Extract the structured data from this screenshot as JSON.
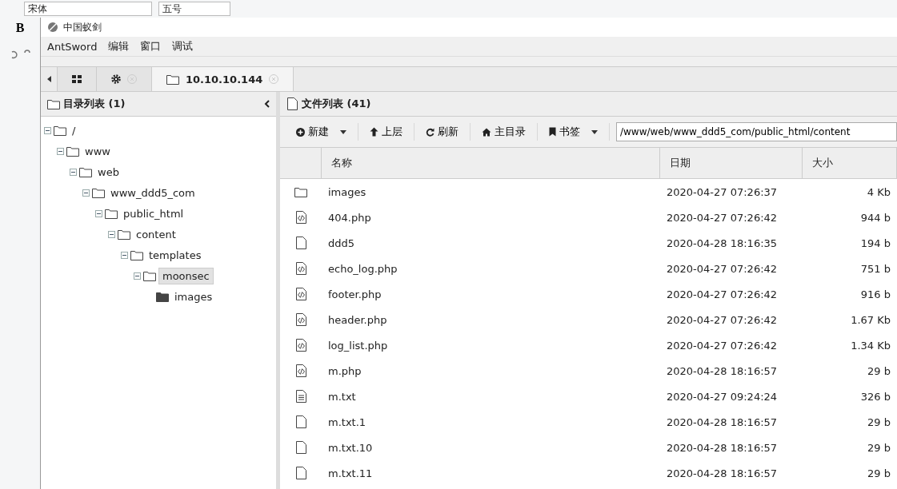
{
  "background_app": {
    "font_field": "宋体",
    "size_field": "五号",
    "bold_key": "B"
  },
  "window": {
    "title": "中国蚁剑"
  },
  "menu": [
    "AntSword",
    "编辑",
    "窗口",
    "调试"
  ],
  "tabs": [
    {
      "kind": "home",
      "selected": false
    },
    {
      "kind": "settings",
      "selected": false
    },
    {
      "kind": "host",
      "label": "10.10.10.144",
      "selected": true
    }
  ],
  "dir_panel": {
    "title": "目录列表 (1)",
    "tree": [
      {
        "label": "/",
        "selected": false,
        "children": [
          {
            "label": "www",
            "selected": false,
            "children": [
              {
                "label": "web",
                "selected": false,
                "children": [
                  {
                    "label": "www_ddd5_com",
                    "selected": false,
                    "children": [
                      {
                        "label": "public_html",
                        "selected": false,
                        "children": [
                          {
                            "label": "content",
                            "selected": false,
                            "children": [
                              {
                                "label": "templates",
                                "selected": false,
                                "children": [
                                  {
                                    "label": "moonsec",
                                    "selected": true,
                                    "children": [
                                      {
                                        "label": "images",
                                        "selected": false
                                      }
                                    ]
                                  }
                                ]
                              }
                            ]
                          }
                        ]
                      }
                    ]
                  }
                ]
              }
            ]
          }
        ]
      }
    ]
  },
  "file_panel": {
    "title": "文件列表 (41)",
    "toolbar": [
      {
        "kind": "new",
        "label": "新建",
        "dropdown": true
      },
      {
        "kind": "up",
        "label": "上层",
        "dropdown": false
      },
      {
        "kind": "refresh",
        "label": "刷新",
        "dropdown": false
      },
      {
        "kind": "home",
        "label": "主目录",
        "dropdown": false
      },
      {
        "kind": "bookmark",
        "label": "书签",
        "dropdown": true
      }
    ],
    "path": "/www/web/www_ddd5_com/public_html/content",
    "columns": [
      "名称",
      "日期",
      "大小"
    ],
    "rows": [
      {
        "kind": "folder",
        "name": "images",
        "date": "2020-04-27 07:26:37",
        "size": "4 Kb"
      },
      {
        "kind": "code",
        "name": "404.php",
        "date": "2020-04-27 07:26:42",
        "size": "944 b"
      },
      {
        "kind": "file",
        "name": "ddd5",
        "date": "2020-04-28 18:16:35",
        "size": "194 b"
      },
      {
        "kind": "code",
        "name": "echo_log.php",
        "date": "2020-04-27 07:26:42",
        "size": "751 b"
      },
      {
        "kind": "code",
        "name": "footer.php",
        "date": "2020-04-27 07:26:42",
        "size": "916 b"
      },
      {
        "kind": "code",
        "name": "header.php",
        "date": "2020-04-27 07:26:42",
        "size": "1.67 Kb"
      },
      {
        "kind": "code",
        "name": "log_list.php",
        "date": "2020-04-27 07:26:42",
        "size": "1.34 Kb"
      },
      {
        "kind": "code",
        "name": "m.php",
        "date": "2020-04-28 18:16:57",
        "size": "29 b"
      },
      {
        "kind": "text",
        "name": "m.txt",
        "date": "2020-04-27 09:24:24",
        "size": "326 b"
      },
      {
        "kind": "file",
        "name": "m.txt.1",
        "date": "2020-04-28 18:16:57",
        "size": "29 b"
      },
      {
        "kind": "file",
        "name": "m.txt.10",
        "date": "2020-04-28 18:16:57",
        "size": "29 b"
      },
      {
        "kind": "file",
        "name": "m.txt.11",
        "date": "2020-04-28 18:16:57",
        "size": "29 b"
      }
    ]
  }
}
